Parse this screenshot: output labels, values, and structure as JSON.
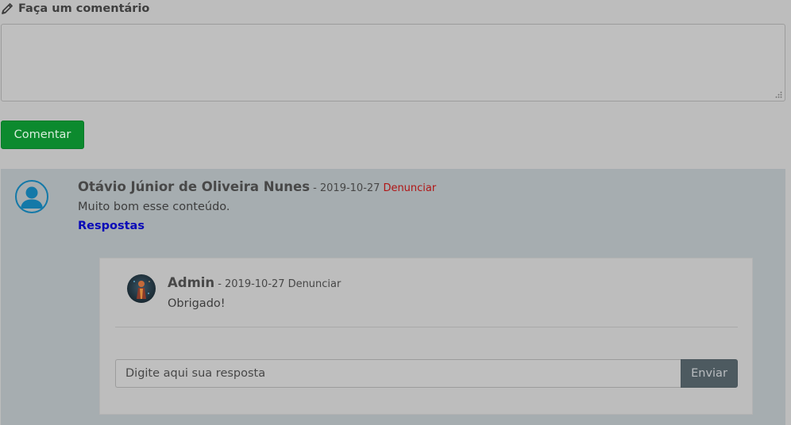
{
  "comment_form": {
    "heading": "Faça um comentário",
    "heading_icon": "pencil-icon",
    "textarea_value": "",
    "submit_label": "Comentar"
  },
  "comments": [
    {
      "avatar_icon": "user-avatar-icon",
      "author": "Otávio Júnior de Oliveira Nunes",
      "date": "- 2019-10-27",
      "report_label": "Denunciar",
      "text": "Muito bom esse conteúdo.",
      "replies_label": "Respostas",
      "replies": [
        {
          "avatar_icon": "admin-avatar-image",
          "author": "Admin",
          "date": "- 2019-10-27",
          "report_label": "Denunciar",
          "text": "Obrigado!"
        }
      ],
      "reply_form": {
        "placeholder": "Digite aqui sua resposta",
        "submit_label": "Enviar"
      }
    }
  ],
  "colors": {
    "page_bg": "#bdbdbd",
    "comment_bg": "#a6adb0",
    "submit_green": "#0c8a2e",
    "report_red": "#b01616",
    "replies_blue": "#0a0ab8",
    "send_button": "#4d5a60"
  }
}
